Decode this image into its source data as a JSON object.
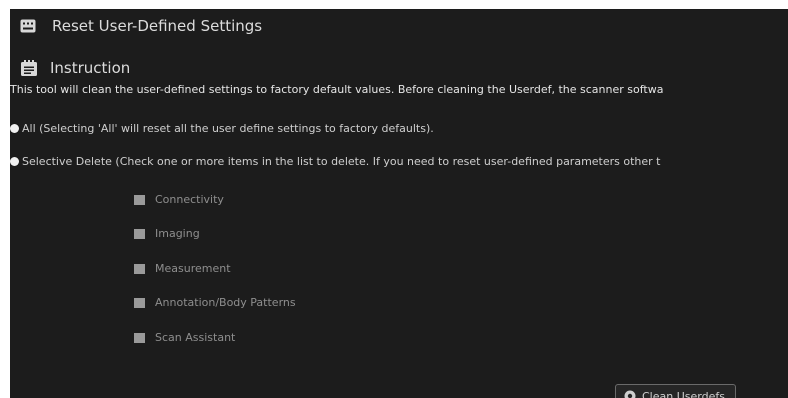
{
  "window": {
    "title": "Reset User-Defined Settings",
    "title_icon": "settings-tray-icon"
  },
  "instruction": {
    "heading": "Instruction",
    "heading_icon": "notepad-icon",
    "text": "This tool will clean the user-defined settings to factory default values. Before cleaning the Userdef, the scanner softwa"
  },
  "options": {
    "all_label": "All (Selecting 'All' will reset all the user define settings to factory defaults).",
    "selective_label": "Selective Delete (Check one or more items in the list to delete. If you need to reset user-defined parameters other t"
  },
  "items": [
    "Connectivity",
    "Imaging",
    "Measurement",
    "Annotation/Body Patterns",
    "Scan Assistant"
  ],
  "button": {
    "label": "Clean Userdefs",
    "icon": "clean-icon"
  },
  "colors": {
    "background": "#1c1c1c",
    "text": "#dcdcdc",
    "disabled_text": "#8e8e8e",
    "checkbox": "#9a9a9a"
  }
}
